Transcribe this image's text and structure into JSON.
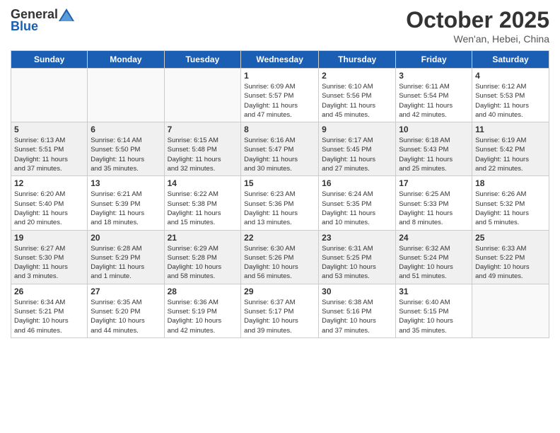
{
  "header": {
    "logo_general": "General",
    "logo_blue": "Blue",
    "month_title": "October 2025",
    "location": "Wen'an, Hebei, China"
  },
  "weekdays": [
    "Sunday",
    "Monday",
    "Tuesday",
    "Wednesday",
    "Thursday",
    "Friday",
    "Saturday"
  ],
  "weeks": [
    [
      {
        "day": "",
        "info": ""
      },
      {
        "day": "",
        "info": ""
      },
      {
        "day": "",
        "info": ""
      },
      {
        "day": "1",
        "info": "Sunrise: 6:09 AM\nSunset: 5:57 PM\nDaylight: 11 hours\nand 47 minutes."
      },
      {
        "day": "2",
        "info": "Sunrise: 6:10 AM\nSunset: 5:56 PM\nDaylight: 11 hours\nand 45 minutes."
      },
      {
        "day": "3",
        "info": "Sunrise: 6:11 AM\nSunset: 5:54 PM\nDaylight: 11 hours\nand 42 minutes."
      },
      {
        "day": "4",
        "info": "Sunrise: 6:12 AM\nSunset: 5:53 PM\nDaylight: 11 hours\nand 40 minutes."
      }
    ],
    [
      {
        "day": "5",
        "info": "Sunrise: 6:13 AM\nSunset: 5:51 PM\nDaylight: 11 hours\nand 37 minutes."
      },
      {
        "day": "6",
        "info": "Sunrise: 6:14 AM\nSunset: 5:50 PM\nDaylight: 11 hours\nand 35 minutes."
      },
      {
        "day": "7",
        "info": "Sunrise: 6:15 AM\nSunset: 5:48 PM\nDaylight: 11 hours\nand 32 minutes."
      },
      {
        "day": "8",
        "info": "Sunrise: 6:16 AM\nSunset: 5:47 PM\nDaylight: 11 hours\nand 30 minutes."
      },
      {
        "day": "9",
        "info": "Sunrise: 6:17 AM\nSunset: 5:45 PM\nDaylight: 11 hours\nand 27 minutes."
      },
      {
        "day": "10",
        "info": "Sunrise: 6:18 AM\nSunset: 5:43 PM\nDaylight: 11 hours\nand 25 minutes."
      },
      {
        "day": "11",
        "info": "Sunrise: 6:19 AM\nSunset: 5:42 PM\nDaylight: 11 hours\nand 22 minutes."
      }
    ],
    [
      {
        "day": "12",
        "info": "Sunrise: 6:20 AM\nSunset: 5:40 PM\nDaylight: 11 hours\nand 20 minutes."
      },
      {
        "day": "13",
        "info": "Sunrise: 6:21 AM\nSunset: 5:39 PM\nDaylight: 11 hours\nand 18 minutes."
      },
      {
        "day": "14",
        "info": "Sunrise: 6:22 AM\nSunset: 5:38 PM\nDaylight: 11 hours\nand 15 minutes."
      },
      {
        "day": "15",
        "info": "Sunrise: 6:23 AM\nSunset: 5:36 PM\nDaylight: 11 hours\nand 13 minutes."
      },
      {
        "day": "16",
        "info": "Sunrise: 6:24 AM\nSunset: 5:35 PM\nDaylight: 11 hours\nand 10 minutes."
      },
      {
        "day": "17",
        "info": "Sunrise: 6:25 AM\nSunset: 5:33 PM\nDaylight: 11 hours\nand 8 minutes."
      },
      {
        "day": "18",
        "info": "Sunrise: 6:26 AM\nSunset: 5:32 PM\nDaylight: 11 hours\nand 5 minutes."
      }
    ],
    [
      {
        "day": "19",
        "info": "Sunrise: 6:27 AM\nSunset: 5:30 PM\nDaylight: 11 hours\nand 3 minutes."
      },
      {
        "day": "20",
        "info": "Sunrise: 6:28 AM\nSunset: 5:29 PM\nDaylight: 11 hours\nand 1 minute."
      },
      {
        "day": "21",
        "info": "Sunrise: 6:29 AM\nSunset: 5:28 PM\nDaylight: 10 hours\nand 58 minutes."
      },
      {
        "day": "22",
        "info": "Sunrise: 6:30 AM\nSunset: 5:26 PM\nDaylight: 10 hours\nand 56 minutes."
      },
      {
        "day": "23",
        "info": "Sunrise: 6:31 AM\nSunset: 5:25 PM\nDaylight: 10 hours\nand 53 minutes."
      },
      {
        "day": "24",
        "info": "Sunrise: 6:32 AM\nSunset: 5:24 PM\nDaylight: 10 hours\nand 51 minutes."
      },
      {
        "day": "25",
        "info": "Sunrise: 6:33 AM\nSunset: 5:22 PM\nDaylight: 10 hours\nand 49 minutes."
      }
    ],
    [
      {
        "day": "26",
        "info": "Sunrise: 6:34 AM\nSunset: 5:21 PM\nDaylight: 10 hours\nand 46 minutes."
      },
      {
        "day": "27",
        "info": "Sunrise: 6:35 AM\nSunset: 5:20 PM\nDaylight: 10 hours\nand 44 minutes."
      },
      {
        "day": "28",
        "info": "Sunrise: 6:36 AM\nSunset: 5:19 PM\nDaylight: 10 hours\nand 42 minutes."
      },
      {
        "day": "29",
        "info": "Sunrise: 6:37 AM\nSunset: 5:17 PM\nDaylight: 10 hours\nand 39 minutes."
      },
      {
        "day": "30",
        "info": "Sunrise: 6:38 AM\nSunset: 5:16 PM\nDaylight: 10 hours\nand 37 minutes."
      },
      {
        "day": "31",
        "info": "Sunrise: 6:40 AM\nSunset: 5:15 PM\nDaylight: 10 hours\nand 35 minutes."
      },
      {
        "day": "",
        "info": ""
      }
    ]
  ]
}
